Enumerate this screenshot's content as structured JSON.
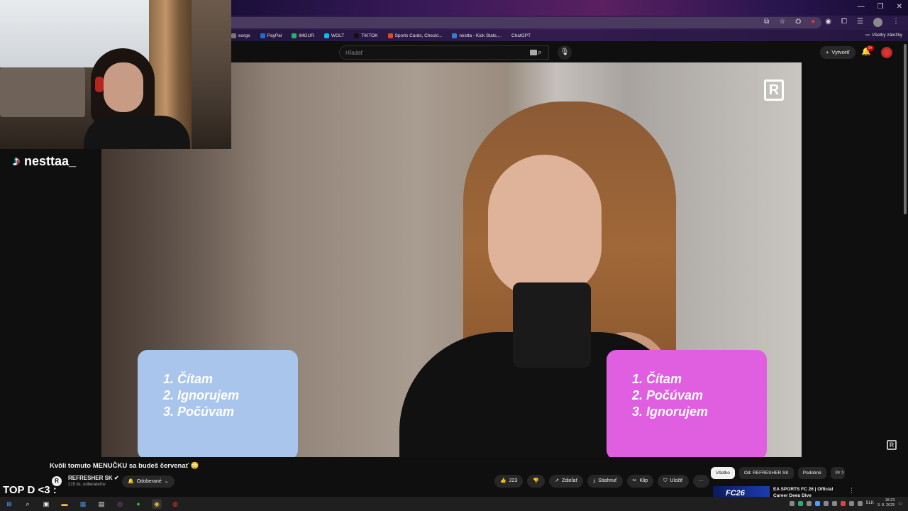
{
  "browser": {
    "window_controls": [
      "—",
      "❐",
      "✕"
    ],
    "bookmarks": [
      {
        "label": "eorge",
        "color": "#777777"
      },
      {
        "label": "PayPal",
        "color": "#1c6fd1"
      },
      {
        "label": "IMGUR",
        "color": "#1bb76e"
      },
      {
        "label": "WOLT",
        "color": "#00c2e8"
      },
      {
        "label": "TIKTOK",
        "color": "#111111"
      },
      {
        "label": "Sports Cards, Checkl...",
        "color": "#e04a1a"
      },
      {
        "label": "nestta - Kick Stats,...",
        "color": "#3a7bd5"
      },
      {
        "label": "ChatGPT",
        "color": "#10a37f"
      }
    ],
    "all_bookmarks": "Všetky záložky"
  },
  "youtube": {
    "search_placeholder": "Hľadať",
    "create_label": "Vytvoriť",
    "notif_count": "9+",
    "video": {
      "card_left": [
        "1. Čítam",
        "2. Ignorujem",
        "3. Počúvam"
      ],
      "card_right": [
        "1. Čítam",
        "2. Počúvam",
        "3. Ignorujem"
      ],
      "logo_letter": "R"
    },
    "title": "Kvôli tomuto MENUČKU sa budeš červenať 😳",
    "channel": {
      "name": "REFRESHER SK",
      "subs": "215 tis. odberateľov",
      "logo": "R",
      "subscribed_label": "Odoberané"
    },
    "actions": {
      "likes": "223",
      "share": "Zdieľať",
      "download": "Stiahnuť",
      "clip": "Klip",
      "save": "Uložiť",
      "more": "···"
    },
    "chips": [
      "Všetko",
      "Od: REFRESHER SK",
      "Podobné",
      "Pr"
    ],
    "recommended": {
      "thumb_text": "FC26",
      "title": "EA SPORTS FC 26 | Official Career Deep Dive"
    }
  },
  "overlay": {
    "tiktok_handle": "nesttaa_",
    "top_text": "TOP D <3 :"
  },
  "taskbar": {
    "lang": "SLK",
    "time": "18:23",
    "date": "3. 8. 2025"
  }
}
